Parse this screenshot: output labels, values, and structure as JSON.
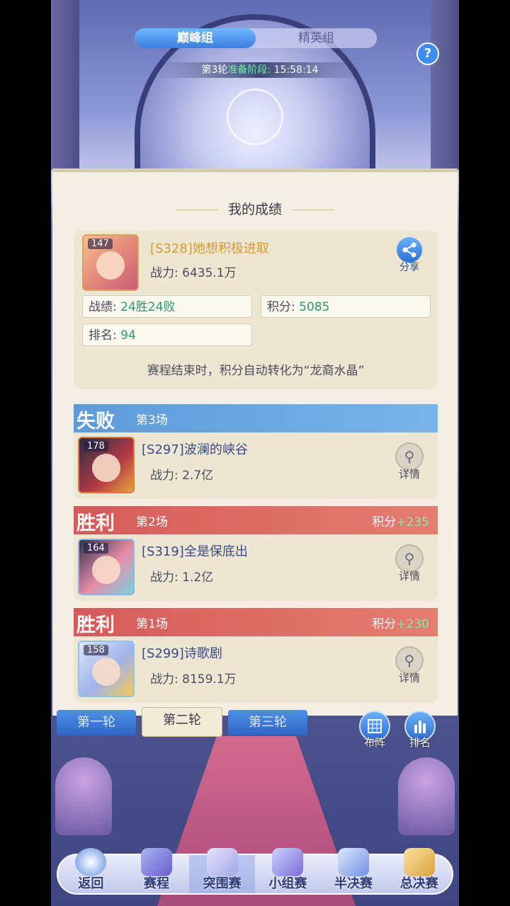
{
  "colors": {
    "accent_blue": "#3d7fe0",
    "win_red": "#d55a5a",
    "lose_blue": "#5c9bd8",
    "power_green": "#2e9b6a",
    "gold_name": "#d89b2c"
  },
  "group_tabs": [
    {
      "label": "巅峰组",
      "active": true
    },
    {
      "label": "精英组",
      "active": false
    }
  ],
  "help_icon": "?",
  "timer": {
    "round": "第3轮",
    "stage": "准备阶段:",
    "time": "15:58:14"
  },
  "my_record": {
    "title": "我的成绩",
    "level": "147",
    "name": "[S328]她想积极进取",
    "power_label": "战力:",
    "power_value": "6435.1万",
    "share_label": "分享",
    "record_label": "战绩:",
    "record_value": "24胜24败",
    "points_label": "积分:",
    "points_value": "5085",
    "rank_label": "排名:",
    "rank_value": "94",
    "note": "赛程结束时，积分自动转化为“龙裔水晶”"
  },
  "matches": [
    {
      "result": "失败",
      "round": "第3场",
      "score_label": "",
      "score_value": "",
      "level": "178",
      "name": "[S297]波澜的峡谷",
      "power_label": "战力:",
      "power_value": "2.7亿",
      "detail_label": "详情"
    },
    {
      "result": "胜利",
      "round": "第2场",
      "score_label": "积分",
      "score_value": "+235",
      "level": "164",
      "name": "[S319]全是保底出",
      "power_label": "战力:",
      "power_value": "1.2亿",
      "detail_label": "详情"
    },
    {
      "result": "胜利",
      "round": "第1场",
      "score_label": "积分",
      "score_value": "+230",
      "level": "158",
      "name": "[S299]诗歌剧",
      "power_label": "战力:",
      "power_value": "8159.1万",
      "detail_label": "详情"
    }
  ],
  "round_tabs": [
    {
      "label": "第一轮",
      "active": false
    },
    {
      "label": "第二轮",
      "active": true
    },
    {
      "label": "第三轮",
      "active": false
    }
  ],
  "side_buttons": {
    "formation": "布阵",
    "ranking": "排名"
  },
  "bottom_nav": [
    {
      "label": "返回",
      "icon": "back-icon"
    },
    {
      "label": "赛程",
      "icon": "schedule-icon"
    },
    {
      "label": "突围赛",
      "icon": "breakout-icon",
      "active": true
    },
    {
      "label": "小组赛",
      "icon": "group-stage-icon"
    },
    {
      "label": "半决赛",
      "icon": "semifinal-icon"
    },
    {
      "label": "总决赛",
      "icon": "final-icon"
    }
  ]
}
